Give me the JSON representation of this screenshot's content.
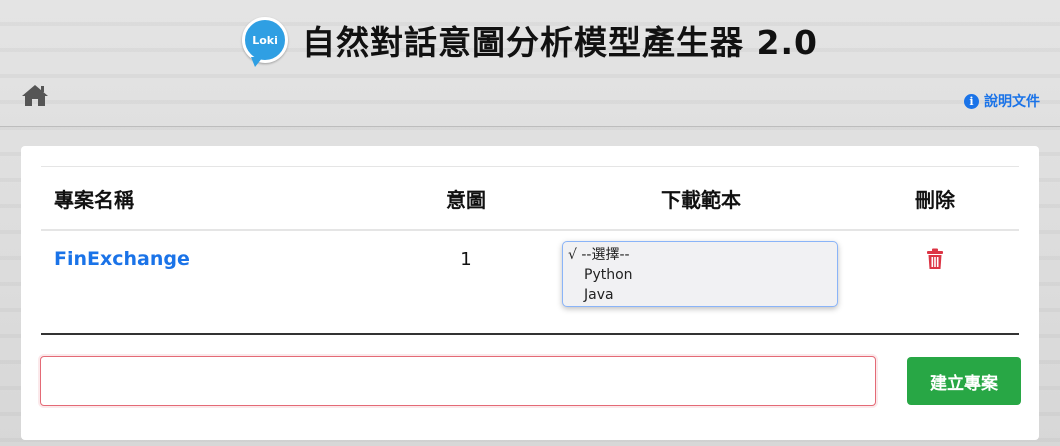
{
  "header": {
    "logo_text": "Loki",
    "title": "自然對話意圖分析模型產生器 2.0",
    "help_link": "說明文件"
  },
  "colors": {
    "accent": "#1a73e8",
    "success": "#28a745",
    "danger": "#dc3545"
  },
  "table": {
    "columns": [
      "專案名稱",
      "意圖",
      "下載範本",
      "刪除"
    ],
    "rows": [
      {
        "project": "FinExchange",
        "intents": "1",
        "download_select": {
          "options": [
            "√ --選擇--",
            "Python",
            "Java"
          ],
          "selected": "--選擇--"
        }
      }
    ]
  },
  "create": {
    "input_value": "",
    "button_label": "建立專案"
  }
}
